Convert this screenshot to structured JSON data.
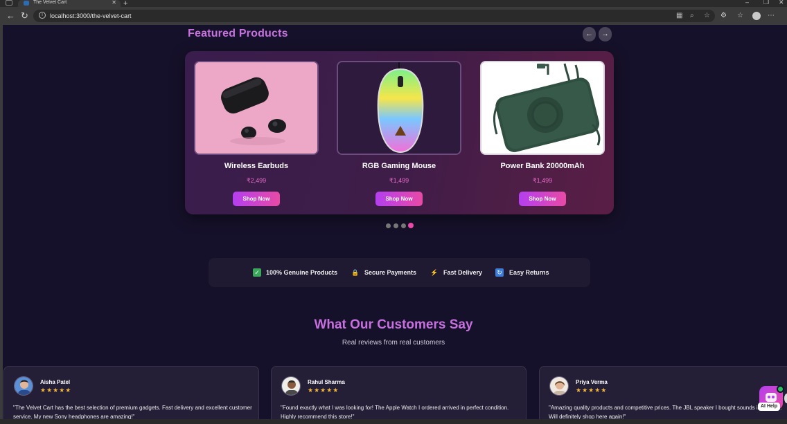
{
  "browser": {
    "tab_title": "The Velvet Cart",
    "url": "localhost:3000/the-velvet-cart"
  },
  "featured": {
    "title": "Featured Products",
    "prev_arrow": "←",
    "next_arrow": "→",
    "products": [
      {
        "name": "Wireless Earbuds",
        "price": "₹2,499",
        "button": "Shop Now"
      },
      {
        "name": "RGB Gaming Mouse",
        "price": "₹1,499",
        "button": "Shop Now"
      },
      {
        "name": "Power Bank 20000mAh",
        "price": "₹1,499",
        "button": "Shop Now"
      }
    ],
    "carousel_pages": 4,
    "active_page": 4
  },
  "trust": {
    "items": [
      {
        "label": "100% Genuine Products",
        "icon": "check-icon"
      },
      {
        "label": "Secure Payments",
        "icon": "lock-icon"
      },
      {
        "label": "Fast Delivery",
        "icon": "lightning-icon"
      },
      {
        "label": "Easy Returns",
        "icon": "returns-icon"
      }
    ]
  },
  "reviews": {
    "title": "What Our Customers Say",
    "subtitle": "Real reviews from real customers",
    "items": [
      {
        "name": "Aisha Patel",
        "stars": "★★★★★",
        "text": "\"The Velvet Cart has the best selection of premium gadgets. Fast delivery and excellent customer service. My new Sony headphones are amazing!\""
      },
      {
        "name": "Rahul Sharma",
        "stars": "★★★★★",
        "text": "\"Found exactly what I was looking for! The Apple Watch I ordered arrived in perfect condition. Highly recommend this store!\""
      },
      {
        "name": "Priya Verma",
        "stars": "★★★★★",
        "text": "\"Amazing quality products and competitive prices. The JBL speaker I bought sounds incredible. Will definitely shop here again!\""
      }
    ]
  },
  "ai_help": {
    "label": "AI Help"
  },
  "colors": {
    "accent": "#c970e0",
    "button_start": "#b43ff0",
    "button_end": "#e84aa5",
    "price": "#e66dc9"
  }
}
